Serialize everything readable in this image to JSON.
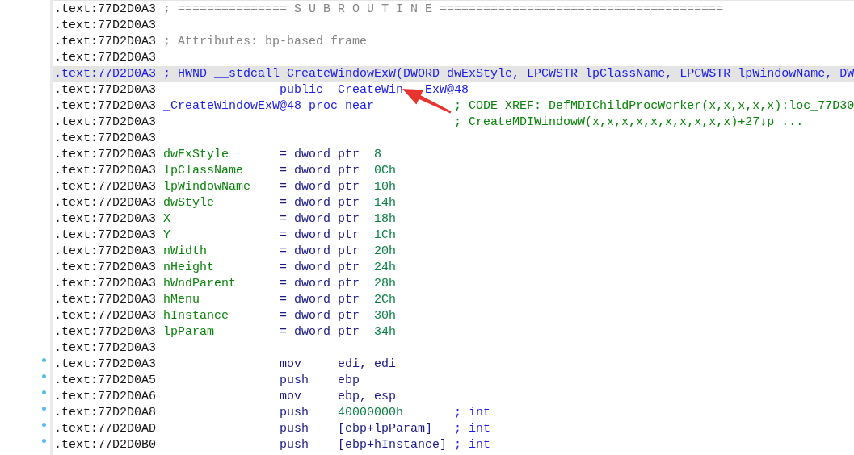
{
  "listing": {
    "lines": [
      {
        "address": ".text:77D2D0A3",
        "selected": false,
        "marked": false,
        "parts": [
          {
            "kind": "comment",
            "text": "; =============== S U B R O U T I N E ======================================="
          }
        ]
      },
      {
        "address": ".text:77D2D0A3",
        "selected": false,
        "marked": false
      },
      {
        "address": ".text:77D2D0A3",
        "selected": false,
        "marked": false,
        "parts": [
          {
            "kind": "comment",
            "text": "; Attributes: bp-based frame"
          }
        ]
      },
      {
        "address": ".text:77D2D0A3",
        "selected": false,
        "marked": false
      },
      {
        "address": ".text:77D2D0A3",
        "selected": true,
        "marked": false,
        "parts": [
          {
            "kind": "prototype",
            "text": "; HWND __stdcall CreateWindowExW(DWORD dwExStyle, LPCWSTR lpClassName, LPCWSTR lpWindowName, DW"
          }
        ]
      },
      {
        "address": ".text:77D2D0A3",
        "selected": false,
        "marked": false,
        "parts": [
          {
            "kind": "directive",
            "text": "public _CreateWin"
          },
          {
            "kind": "covered"
          },
          {
            "kind": "directive",
            "text": "ExW@48"
          }
        ]
      },
      {
        "address": ".text:77D2D0A3",
        "selected": false,
        "marked": false,
        "parts": [
          {
            "kind": "label",
            "text": "_CreateWindowExW@48 proc near"
          },
          {
            "kind": "xref",
            "text": "; CODE XREF: DefMDIChildProcWorker(x,x,x,x,x):loc_77D30"
          }
        ]
      },
      {
        "address": ".text:77D2D0A3",
        "selected": false,
        "marked": false,
        "parts": [
          {
            "kind": "xref",
            "text": "; CreateMDIWindowW(x,x,x,x,x,x,x,x,x,x)+27↓p ..."
          }
        ]
      },
      {
        "address": ".text:77D2D0A3",
        "selected": false,
        "marked": false
      },
      {
        "address": ".text:77D2D0A3",
        "selected": false,
        "marked": false,
        "parts": [
          {
            "kind": "var_name",
            "text": "dwExStyle"
          },
          {
            "kind": "var_def",
            "text": "= dword ptr"
          },
          {
            "kind": "var_offset",
            "text": "8"
          }
        ]
      },
      {
        "address": ".text:77D2D0A3",
        "selected": false,
        "marked": false,
        "parts": [
          {
            "kind": "var_name",
            "text": "lpClassName"
          },
          {
            "kind": "var_def",
            "text": "= dword ptr"
          },
          {
            "kind": "var_offset",
            "text": "0Ch"
          }
        ]
      },
      {
        "address": ".text:77D2D0A3",
        "selected": false,
        "marked": false,
        "parts": [
          {
            "kind": "var_name",
            "text": "lpWindowName"
          },
          {
            "kind": "var_def",
            "text": "= dword ptr"
          },
          {
            "kind": "var_offset",
            "text": "10h"
          }
        ]
      },
      {
        "address": ".text:77D2D0A3",
        "selected": false,
        "marked": false,
        "parts": [
          {
            "kind": "var_name",
            "text": "dwStyle"
          },
          {
            "kind": "var_def",
            "text": "= dword ptr"
          },
          {
            "kind": "var_offset",
            "text": "14h"
          }
        ]
      },
      {
        "address": ".text:77D2D0A3",
        "selected": false,
        "marked": false,
        "parts": [
          {
            "kind": "var_name",
            "text": "X"
          },
          {
            "kind": "var_def",
            "text": "= dword ptr"
          },
          {
            "kind": "var_offset",
            "text": "18h"
          }
        ]
      },
      {
        "address": ".text:77D2D0A3",
        "selected": false,
        "marked": false,
        "parts": [
          {
            "kind": "var_name",
            "text": "Y"
          },
          {
            "kind": "var_def",
            "text": "= dword ptr"
          },
          {
            "kind": "var_offset",
            "text": "1Ch"
          }
        ]
      },
      {
        "address": ".text:77D2D0A3",
        "selected": false,
        "marked": false,
        "parts": [
          {
            "kind": "var_name",
            "text": "nWidth"
          },
          {
            "kind": "var_def",
            "text": "= dword ptr"
          },
          {
            "kind": "var_offset",
            "text": "20h"
          }
        ]
      },
      {
        "address": ".text:77D2D0A3",
        "selected": false,
        "marked": false,
        "parts": [
          {
            "kind": "var_name",
            "text": "nHeight"
          },
          {
            "kind": "var_def",
            "text": "= dword ptr"
          },
          {
            "kind": "var_offset",
            "text": "24h"
          }
        ]
      },
      {
        "address": ".text:77D2D0A3",
        "selected": false,
        "marked": false,
        "parts": [
          {
            "kind": "var_name",
            "text": "hWndParent"
          },
          {
            "kind": "var_def",
            "text": "= dword ptr"
          },
          {
            "kind": "var_offset",
            "text": "28h"
          }
        ]
      },
      {
        "address": ".text:77D2D0A3",
        "selected": false,
        "marked": false,
        "parts": [
          {
            "kind": "var_name",
            "text": "hMenu"
          },
          {
            "kind": "var_def",
            "text": "= dword ptr"
          },
          {
            "kind": "var_offset",
            "text": "2Ch"
          }
        ]
      },
      {
        "address": ".text:77D2D0A3",
        "selected": false,
        "marked": false,
        "parts": [
          {
            "kind": "var_name",
            "text": "hInstance"
          },
          {
            "kind": "var_def",
            "text": "= dword ptr"
          },
          {
            "kind": "var_offset",
            "text": "30h"
          }
        ]
      },
      {
        "address": ".text:77D2D0A3",
        "selected": false,
        "marked": false,
        "parts": [
          {
            "kind": "var_name",
            "text": "lpParam"
          },
          {
            "kind": "var_def",
            "text": "= dword ptr"
          },
          {
            "kind": "var_offset",
            "text": "34h"
          }
        ]
      },
      {
        "address": ".text:77D2D0A3",
        "selected": false,
        "marked": false
      },
      {
        "address": ".text:77D2D0A3",
        "selected": false,
        "marked": true,
        "parts": [
          {
            "kind": "mnemonic",
            "text": "mov"
          },
          {
            "kind": "operand",
            "text": "edi, edi"
          }
        ]
      },
      {
        "address": ".text:77D2D0A5",
        "selected": false,
        "marked": true,
        "parts": [
          {
            "kind": "mnemonic",
            "text": "push"
          },
          {
            "kind": "operand",
            "text": "ebp"
          }
        ]
      },
      {
        "address": ".text:77D2D0A6",
        "selected": false,
        "marked": true,
        "parts": [
          {
            "kind": "mnemonic",
            "text": "mov"
          },
          {
            "kind": "operand",
            "text": "ebp, esp"
          }
        ]
      },
      {
        "address": ".text:77D2D0A8",
        "selected": false,
        "marked": true,
        "parts": [
          {
            "kind": "mnemonic",
            "text": "push"
          },
          {
            "kind": "immediate",
            "text": "40000000h"
          },
          {
            "kind": "type_note",
            "text": "; int"
          }
        ]
      },
      {
        "address": ".text:77D2D0AD",
        "selected": false,
        "marked": true,
        "parts": [
          {
            "kind": "mnemonic",
            "text": "push"
          },
          {
            "kind": "operand",
            "text": "[ebp+lpParam]"
          },
          {
            "kind": "type_note",
            "text": "; int"
          }
        ]
      },
      {
        "address": ".text:77D2D0B0",
        "selected": false,
        "marked": true,
        "parts": [
          {
            "kind": "mnemonic",
            "text": "push"
          },
          {
            "kind": "operand",
            "text": "[ebp+hInstance]"
          },
          {
            "kind": "type_note",
            "text": "; int"
          }
        ]
      }
    ]
  },
  "annotations": [
    {
      "kind": "arrow"
    }
  ]
}
